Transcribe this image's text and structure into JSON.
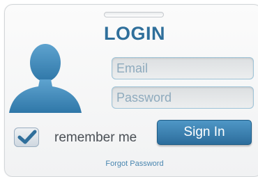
{
  "login": {
    "title": "LOGIN",
    "email_placeholder": "Email",
    "password_placeholder": "Password",
    "remember_label": "remember me",
    "remember_checked": true,
    "signin_label": "Sign In",
    "forgot_label": "Forgot Password"
  },
  "icons": {
    "avatar": "user-silhouette",
    "checkbox": "checkmark"
  },
  "colors": {
    "accent": "#2f6f9b",
    "avatar": "#3b86b6",
    "button": "#3b82b5",
    "link": "#4a86b0"
  }
}
